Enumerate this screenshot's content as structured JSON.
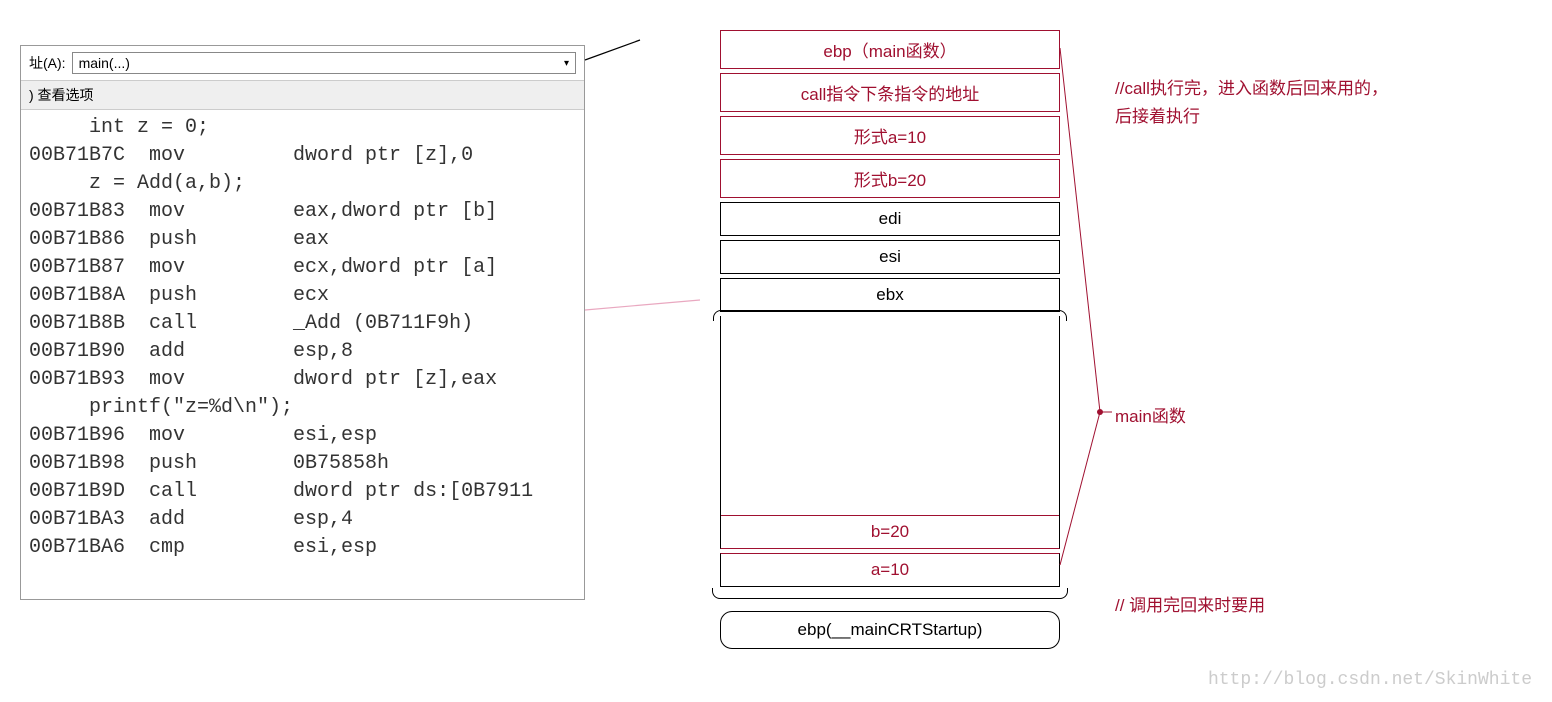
{
  "codePanel": {
    "addressLabel": "址(A):",
    "dropdownValue": "main(...)",
    "subheader": ") 查看选项",
    "codeLines": [
      "     int z = 0;",
      "00B71B7C  mov         dword ptr [z],0",
      "     z = Add(a,b);",
      "00B71B83  mov         eax,dword ptr [b]",
      "00B71B86  push        eax",
      "00B71B87  mov         ecx,dword ptr [a]",
      "00B71B8A  push        ecx",
      "00B71B8B  call        _Add (0B711F9h)",
      "00B71B90  add         esp,8",
      "00B71B93  mov         dword ptr [z],eax",
      "     printf(\"z=%d\\n\");",
      "00B71B96  mov         esi,esp",
      "00B71B98  push        0B75858h",
      "00B71B9D  call        dword ptr ds:[0B7911",
      "00B71BA3  add         esp,4",
      "00B71BA6  cmp         esi,esp"
    ]
  },
  "stack": {
    "cells": [
      "ebp（main函数）",
      "call指令下条指令的地址",
      "形式a=10",
      "形式b=20",
      "edi",
      "esi",
      "ebx"
    ],
    "b20": "b=20",
    "a10": "a=10",
    "ebpBottom": "ebp(__mainCRTStartup)"
  },
  "annotations": {
    "callNote": "//call执行完，进入函数后回来用的，后接着执行",
    "mainLabel": "main函数",
    "returnNote": "// 调用完回来时要用"
  },
  "watermark": "http://blog.csdn.net/SkinWhite"
}
